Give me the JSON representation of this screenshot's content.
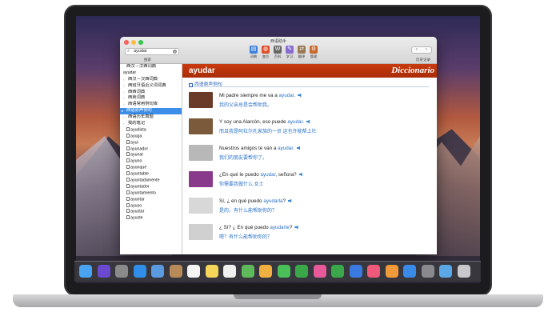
{
  "window": {
    "title": "西语助手"
  },
  "search": {
    "value": "ayudar",
    "caption": "搜索"
  },
  "toolbar": {
    "items": [
      {
        "label": "词典",
        "icon": "dictionary-icon",
        "color": "#3d7fd9"
      },
      {
        "label": "变位",
        "icon": "conjugation-icon",
        "color": "#e0502c"
      },
      {
        "label": "百科",
        "icon": "wiki-icon",
        "color": "#666666"
      },
      {
        "label": "学习",
        "icon": "study-icon",
        "color": "#8a6bd0"
      },
      {
        "label": "翻译",
        "icon": "translate-icon",
        "color": "#9a7a55"
      },
      {
        "label": "管理",
        "icon": "manage-icon",
        "color": "#c8692a"
      }
    ],
    "nav_caption": "历史记录",
    "back": "‹",
    "forward": "›"
  },
  "sidebar": {
    "items": [
      {
        "label": "西汉－汉西词典"
      },
      {
        "label": "ayudar"
      },
      {
        "label": "西汉－汉西词典"
      },
      {
        "label": "西班牙语近义词词典"
      },
      {
        "label": "西西词典"
      },
      {
        "label": "西英词典"
      },
      {
        "label": "西语常用例句库"
      },
      {
        "label": "西语原声例句"
      },
      {
        "label": "西语历年真题"
      },
      {
        "label": "我的笔记"
      },
      {
        "label": "ayudista"
      },
      {
        "label": "ayuga"
      },
      {
        "label": "ayui"
      },
      {
        "label": "ayunador"
      },
      {
        "label": "ayunar"
      },
      {
        "label": "ayuno"
      },
      {
        "label": "ayunque"
      },
      {
        "label": "ayuntable"
      },
      {
        "label": "ayuntadamente"
      },
      {
        "label": "ayuntador"
      },
      {
        "label": "ayuntamiento"
      },
      {
        "label": "ayuntar"
      },
      {
        "label": "ayuso"
      },
      {
        "label": "ayustar"
      },
      {
        "label": "ayuste"
      }
    ]
  },
  "content": {
    "headword": "ayudar",
    "brand": "Diccionario",
    "section_title": "西语原声例句",
    "examples": [
      {
        "pre": "Mi padre siempre me va a ",
        "hl": "ayudar",
        "post": ".",
        "zh": "我的父亲总是会帮助我。",
        "thumb": "#6b3b2a"
      },
      {
        "pre": "Y soy una Alarcón, eso puede ",
        "hl": "ayudar",
        "post": ".",
        "zh": "而且我是阿拉尔孔家族的一员 这也许能帮上忙",
        "thumb": "#7a5a3a"
      },
      {
        "pre": "Nuestros amigos te van a ",
        "hl": "ayudar",
        "post": ".",
        "zh": "我们的朋友要帮你了。",
        "thumb": "#b8b8b8"
      },
      {
        "pre": "¿En qué le puedo ",
        "hl": "ayudar",
        "post": ", señora?",
        "zh": "你需要我做什么 女士",
        "thumb": "#8a3a8a"
      },
      {
        "pre": "Sí, ¿ en qué puedo ",
        "hl": "ayudarla",
        "post": "?",
        "zh": "是的，有什么能帮助你的？",
        "thumb": "#d8d8d8"
      },
      {
        "pre": "¿ Sí? ¿ En qué puedo ",
        "hl": "ayudarte",
        "post": "?",
        "zh": "嗯？有什么能帮助你的？",
        "thumb": "#d0d0d0"
      }
    ]
  },
  "dock": {
    "icons": [
      {
        "name": "finder-icon",
        "color": "#4aa3f0"
      },
      {
        "name": "siri-icon",
        "color": "#6b4ad0"
      },
      {
        "name": "launchpad-icon",
        "color": "#8a8a8a"
      },
      {
        "name": "safari-icon",
        "color": "#2f8fe8"
      },
      {
        "name": "mail-icon",
        "color": "#5a9ae0"
      },
      {
        "name": "contacts-icon",
        "color": "#b88a5a"
      },
      {
        "name": "calendar-icon",
        "color": "#f4f4f4"
      },
      {
        "name": "notes-icon",
        "color": "#f5d65a"
      },
      {
        "name": "reminders-icon",
        "color": "#f0f0f0"
      },
      {
        "name": "maps-icon",
        "color": "#5fb85a"
      },
      {
        "name": "photos-icon",
        "color": "#f0b040"
      },
      {
        "name": "messages-icon",
        "color": "#4ac05a"
      },
      {
        "name": "facetime-icon",
        "color": "#3aa848"
      },
      {
        "name": "itunes-icon",
        "color": "#e85a9a"
      },
      {
        "name": "numbers-icon",
        "color": "#3aa84a"
      },
      {
        "name": "keynote-icon",
        "color": "#3a7ae0"
      },
      {
        "name": "music-icon",
        "color": "#f05a7a"
      },
      {
        "name": "ibooks-icon",
        "color": "#f09a3a"
      },
      {
        "name": "appstore-icon",
        "color": "#3a8ae8"
      },
      {
        "name": "settings-icon",
        "color": "#8a8a8e"
      },
      {
        "name": "folder-icon",
        "color": "#5aa8e8"
      },
      {
        "name": "trash-icon",
        "color": "#c8c8cc"
      }
    ]
  }
}
